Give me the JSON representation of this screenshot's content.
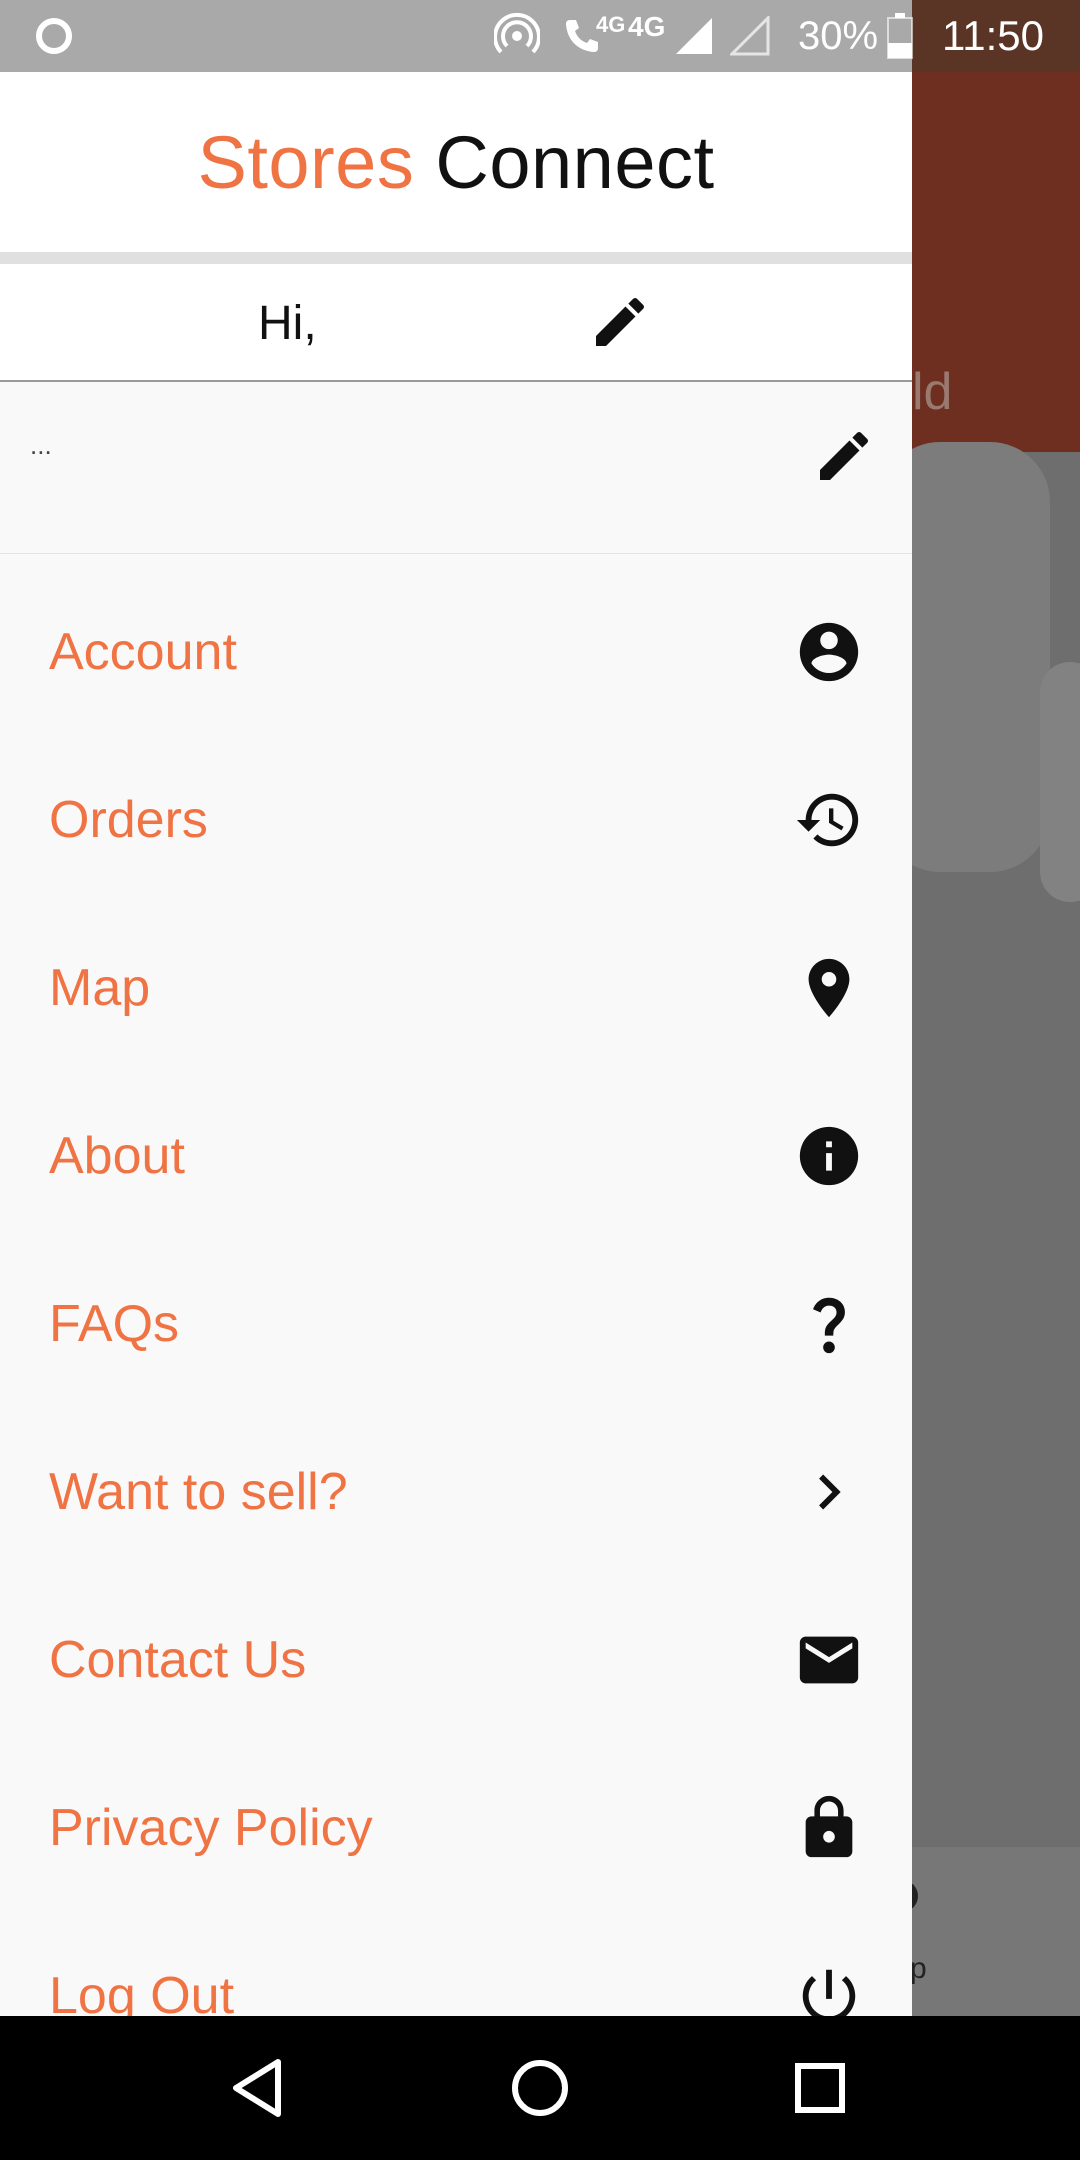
{
  "status_bar": {
    "time": "11:50",
    "battery": "30%",
    "network_primary": "4G",
    "network_call": "4G"
  },
  "background": {
    "title_fragment": "ld",
    "bottom_fragment": "p"
  },
  "drawer": {
    "brand_accent": "Stores",
    "brand_rest": "Connect",
    "greeting": "Hi,",
    "address": "...",
    "menu": [
      {
        "label": "Account",
        "icon": "account-circle-icon"
      },
      {
        "label": "Orders",
        "icon": "history-icon"
      },
      {
        "label": "Map",
        "icon": "location-pin-icon"
      },
      {
        "label": "About",
        "icon": "info-icon"
      },
      {
        "label": "FAQs",
        "icon": "question-mark-icon"
      },
      {
        "label": "Want to sell?",
        "icon": "chevron-right-icon"
      },
      {
        "label": "Contact Us",
        "icon": "mail-icon"
      },
      {
        "label": "Privacy Policy",
        "icon": "lock-icon"
      },
      {
        "label": "Log Out",
        "icon": "power-icon"
      }
    ]
  },
  "colors": {
    "accent": "#f07344",
    "drawer_bg": "#f9f9f9",
    "header_bg": "#6f2f20",
    "scrim": "#6e6e6e"
  }
}
